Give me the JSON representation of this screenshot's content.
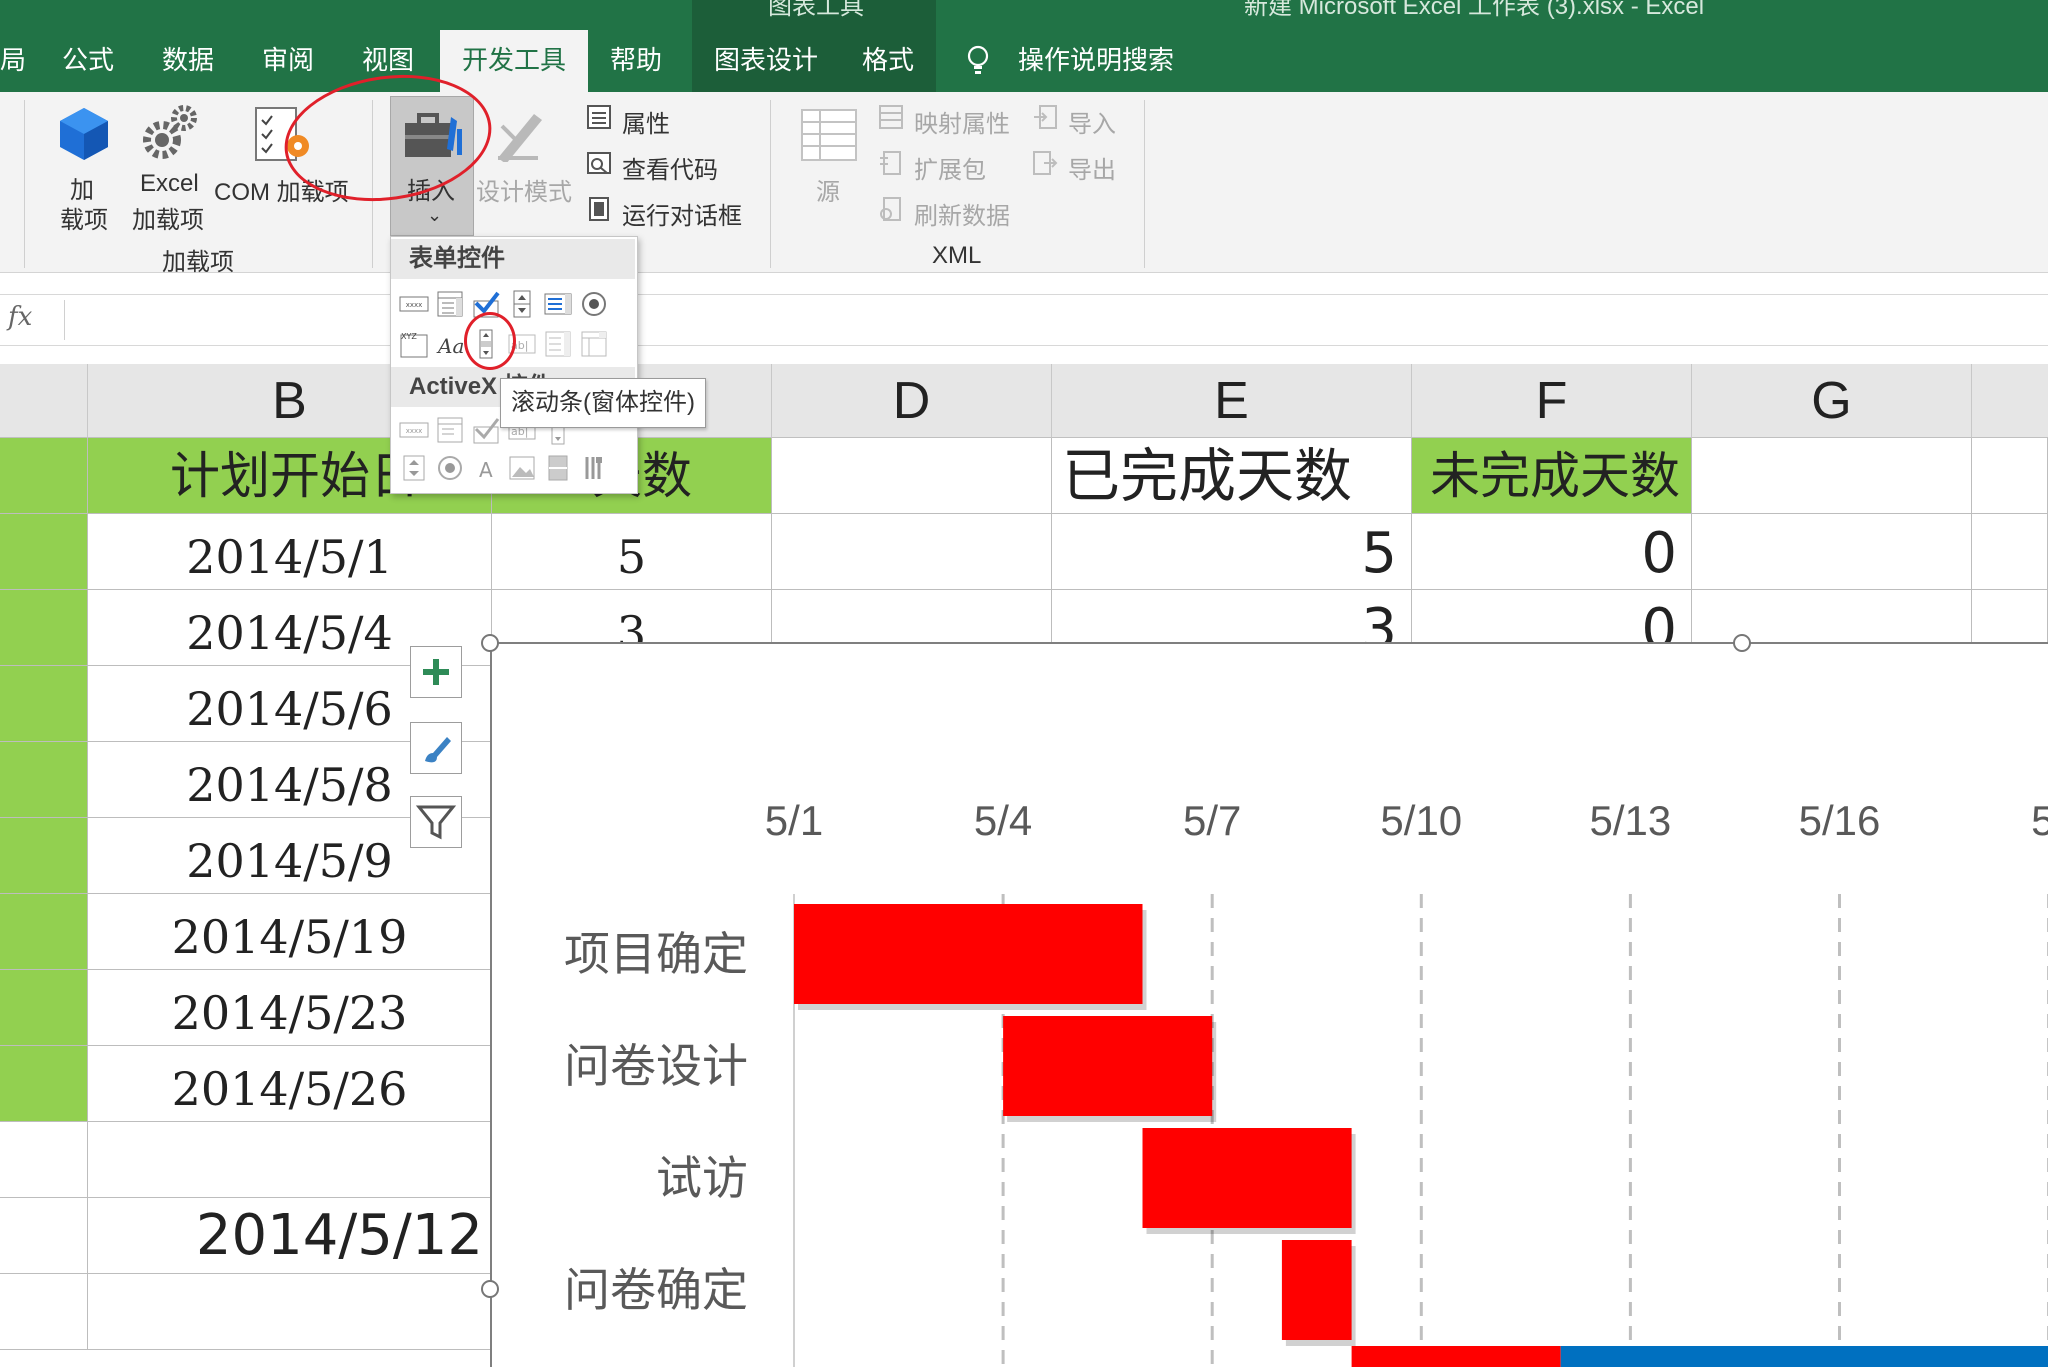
{
  "window": {
    "title_fragment": "新建 Microsoft Excel 工作表 (3).xlsx  -  Excel",
    "context_fragment": "图表工具"
  },
  "tabs": [
    {
      "label": "局",
      "active": false
    },
    {
      "label": "公式",
      "active": false
    },
    {
      "label": "数据",
      "active": false
    },
    {
      "label": "审阅",
      "active": false
    },
    {
      "label": "视图",
      "active": false
    },
    {
      "label": "开发工具",
      "active": true
    },
    {
      "label": "帮助",
      "active": false
    },
    {
      "label": "图表设计",
      "active": false
    },
    {
      "label": "格式",
      "active": false
    }
  ],
  "tell_me": "操作说明搜索",
  "ribbon": {
    "addins_group": {
      "label": "加载项",
      "addins_btn": [
        "加",
        "载项"
      ],
      "excel_addins_btn": [
        "Excel",
        "加载项"
      ],
      "com_addins_btn": "COM 加载项"
    },
    "controls": {
      "insert_btn": "插入",
      "design_mode_btn": "设计模式",
      "properties": "属性",
      "view_code": "查看代码",
      "run_dialog": "运行对话框"
    },
    "xml_group": {
      "label": "XML",
      "source": "源",
      "map_properties": "映射属性",
      "expansion_packs": "扩展包",
      "refresh_data": "刷新数据",
      "import": "导入",
      "export": "导出"
    }
  },
  "formula_bar": {
    "fx": "fx",
    "value": ""
  },
  "columns": [
    "B",
    "D",
    "E",
    "F",
    "G"
  ],
  "sheet": {
    "headers": {
      "b": "计划开始日",
      "c": "天数",
      "e": "已完成天数",
      "f": "未完成天数"
    },
    "rows": [
      {
        "b": "2014/5/1",
        "c": "5",
        "e": "5",
        "f": "0"
      },
      {
        "b": "2014/5/4",
        "c": "3",
        "e": "3",
        "f": "0"
      },
      {
        "b": "2014/5/6"
      },
      {
        "b": "2014/5/8"
      },
      {
        "b": "2014/5/9"
      },
      {
        "b": "2014/5/19"
      },
      {
        "b": "2014/5/23"
      },
      {
        "b": "2014/5/26"
      }
    ],
    "today_value": "2014/5/12"
  },
  "insert_dropdown": {
    "form_controls_label": "表单控件",
    "activex_label": "ActiveX 控件",
    "tooltip": "滚动条(窗体控件)"
  },
  "chart_data": {
    "type": "bar",
    "orientation": "horizontal-gantt",
    "x_tick_labels": [
      "5/1",
      "5/4",
      "5/7",
      "5/10",
      "5/13",
      "5/16",
      "5/"
    ],
    "x_ticks": [
      "2014-05-01",
      "2014-05-04",
      "2014-05-07",
      "2014-05-10",
      "2014-05-13",
      "2014-05-16",
      "2014-05-19"
    ],
    "xlim": [
      "2014-05-01",
      "2014-05-19"
    ],
    "categories": [
      "项目确定",
      "问卷设计",
      "试访",
      "问卷确定"
    ],
    "series": [
      {
        "color": "#ff0000",
        "bars": [
          {
            "category": "项目确定",
            "start": "2014-05-01",
            "end": "2014-05-06"
          },
          {
            "category": "问卷设计",
            "start": "2014-05-04",
            "end": "2014-05-07"
          },
          {
            "category": "试访",
            "start": "2014-05-06",
            "end": "2014-05-09"
          },
          {
            "category": "问卷确定",
            "start": "2014-05-08",
            "end": "2014-05-09"
          }
        ]
      }
    ],
    "partial_bars": [
      {
        "color": "#ff0000",
        "start": "2014-05-09",
        "end": "2014-05-12"
      },
      {
        "color": "#0070c0",
        "start": "2014-05-12",
        "end": "2014-05-19"
      }
    ],
    "grid": "dashed-vertical"
  },
  "colors": {
    "excel_green": "#217346",
    "header_green": "#92d050",
    "bar_red": "#ff0000",
    "bar_blue": "#0070c0",
    "annotation_red": "#e0202a"
  }
}
